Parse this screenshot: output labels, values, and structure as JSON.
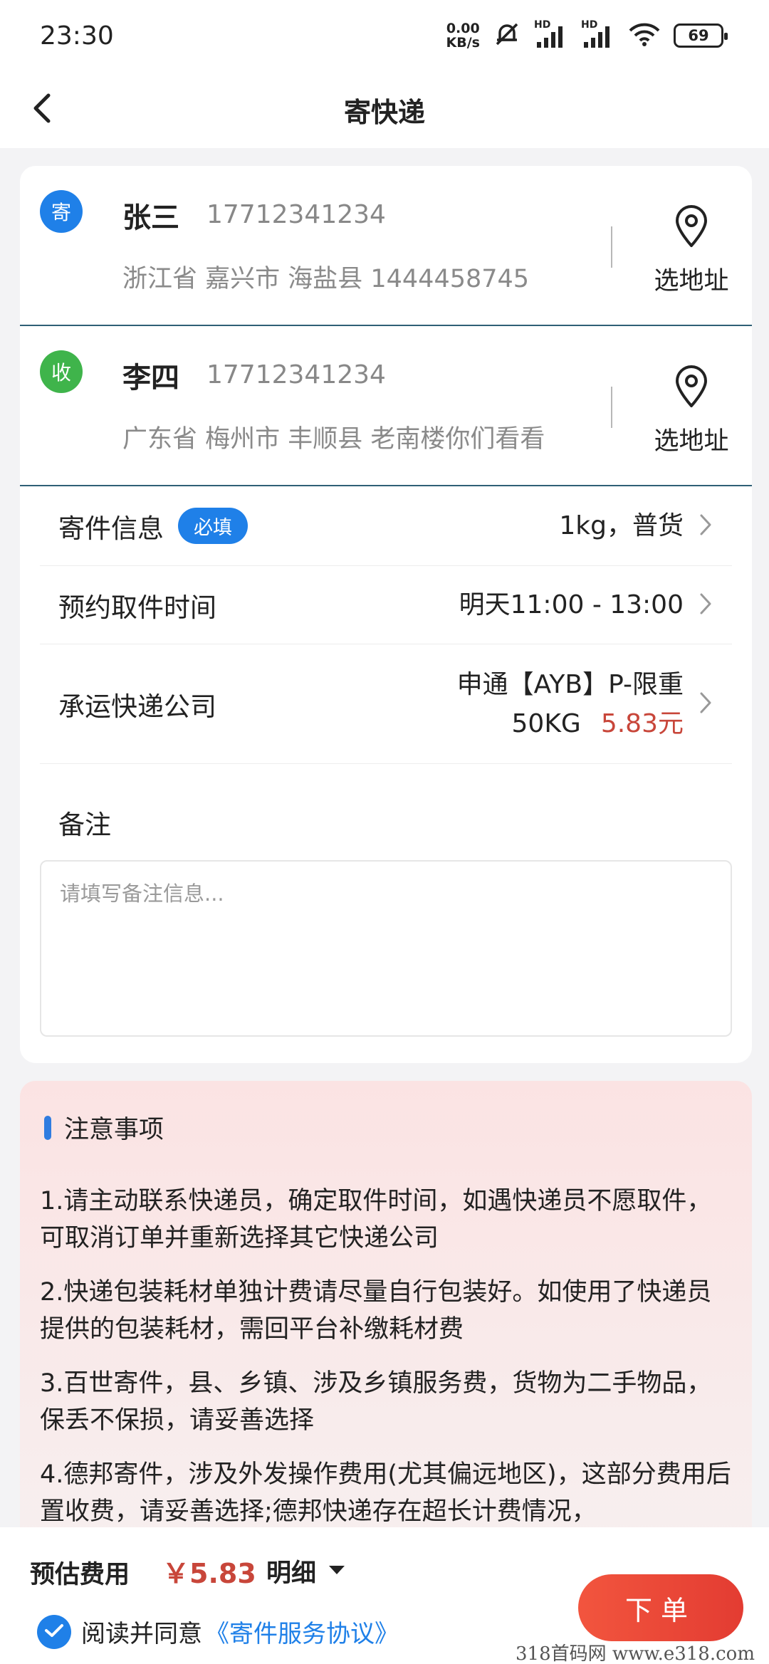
{
  "status": {
    "time": "23:30",
    "net_speed_value": "0.00",
    "net_speed_unit": "KB/s",
    "hd1": "HD",
    "hd2": "HD",
    "battery": "69"
  },
  "header": {
    "title": "寄快递"
  },
  "sender": {
    "badge": "寄",
    "badge_color": "#1f80e8",
    "name": "张三",
    "phone": "17712341234",
    "address": "浙江省 嘉兴市 海盐县 1444458745",
    "select_label": "选地址"
  },
  "receiver": {
    "badge": "收",
    "badge_color": "#3fb44b",
    "name": "李四",
    "phone": "17712341234",
    "address": "广东省 梅州市 丰顺县 老南楼你们看看",
    "select_label": "选地址"
  },
  "rows": {
    "package": {
      "label": "寄件信息",
      "badge": "必填",
      "value": "1kg，普货"
    },
    "pickup": {
      "label": "预约取件时间",
      "value": "明天11:00 - 13:00"
    },
    "carrier": {
      "label": "承运快递公司",
      "value_line1": "申通【AYB】P-限重",
      "value_line2": "50KG",
      "price": "5.83元"
    }
  },
  "remark": {
    "label": "备注",
    "placeholder": "请填写备注信息..."
  },
  "notice": {
    "title": "注意事项",
    "items": [
      "1.请主动联系快递员，确定取件时间，如遇快递员不愿取件，可取消订单并重新选择其它快递公司",
      "2.快递包装耗材单独计费请尽量自行包装好。如使用了快递员提供的包装耗材，需回平台补缴耗材费",
      "3.百世寄件，县、乡镇、涉及乡镇服务费，货物为二手物品，保丢不保损，请妥善选择",
      "4.德邦寄件，涉及外发操作费用(尤其偏远地区)，这部分费用后置收费，请妥善选择;德邦快递存在超长计费情况，"
    ]
  },
  "footer": {
    "fee_label": "预估费用",
    "fee_value": "￥5.83",
    "detail_label": "明细",
    "agree_text": "阅读并同意",
    "agree_link": "《寄件服务协议》",
    "order_label": "下单"
  },
  "colors": {
    "accent": "#1f80e8",
    "price": "#c8463a",
    "order_button": "#e84434"
  },
  "watermark": "318首码网 www.e318.com"
}
